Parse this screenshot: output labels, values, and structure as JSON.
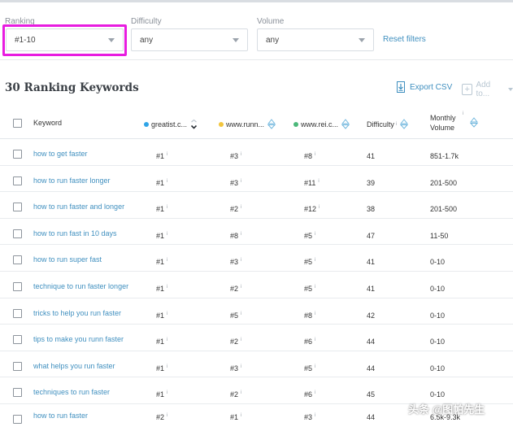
{
  "filters": {
    "ranking": {
      "label": "Ranking",
      "value": "#1-10"
    },
    "difficulty": {
      "label": "Difficulty",
      "value": "any"
    },
    "volume": {
      "label": "Volume",
      "value": "any"
    },
    "reset_label": "Reset filters"
  },
  "section": {
    "title": "30 Ranking Keywords",
    "export_label": "Export CSV",
    "add_label": "Add to..."
  },
  "columns": {
    "keyword": "Keyword",
    "site1": "greatist.c...",
    "site2": "www.runn...",
    "site3": "www.rei.c...",
    "difficulty": "Difficulty",
    "volume_line1": "Monthly",
    "volume_line2": "Volume",
    "info_mark": "i"
  },
  "colors": {
    "site1_dot": "#2fa4e7",
    "site2_dot": "#f2c53d",
    "site3_dot": "#4cb87a",
    "link": "#3f8fbf",
    "highlight": "#e81ce0"
  },
  "rows": [
    {
      "keyword": "how to get faster",
      "site1": "#1",
      "site2": "#3",
      "site3": "#8",
      "difficulty": "41",
      "volume": "851-1.7k"
    },
    {
      "keyword": "how to run faster longer",
      "site1": "#1",
      "site2": "#3",
      "site3": "#11",
      "difficulty": "39",
      "volume": "201-500"
    },
    {
      "keyword": "how to run faster and longer",
      "site1": "#1",
      "site2": "#2",
      "site3": "#12",
      "difficulty": "38",
      "volume": "201-500"
    },
    {
      "keyword": "how to run fast in 10 days",
      "site1": "#1",
      "site2": "#8",
      "site3": "#5",
      "difficulty": "47",
      "volume": "11-50"
    },
    {
      "keyword": "how to run super fast",
      "site1": "#1",
      "site2": "#3",
      "site3": "#5",
      "difficulty": "41",
      "volume": "0-10"
    },
    {
      "keyword": "technique to run faster longer",
      "site1": "#1",
      "site2": "#2",
      "site3": "#5",
      "difficulty": "41",
      "volume": "0-10"
    },
    {
      "keyword": "tricks to help you run faster",
      "site1": "#1",
      "site2": "#5",
      "site3": "#8",
      "difficulty": "42",
      "volume": "0-10"
    },
    {
      "keyword": "tips to make you runn faster",
      "site1": "#1",
      "site2": "#2",
      "site3": "#6",
      "difficulty": "44",
      "volume": "0-10"
    },
    {
      "keyword": "what helps you run faster",
      "site1": "#1",
      "site2": "#3",
      "site3": "#5",
      "difficulty": "44",
      "volume": "0-10"
    },
    {
      "keyword": "techniques to run faster",
      "site1": "#1",
      "site2": "#2",
      "site3": "#6",
      "difficulty": "45",
      "volume": "0-10"
    },
    {
      "keyword": "how to run faster",
      "site1": "#2",
      "site2": "#1",
      "site3": "#3",
      "difficulty": "44",
      "volume": "6.5k-9.3k"
    }
  ],
  "watermark": "头条 @图帕先生"
}
